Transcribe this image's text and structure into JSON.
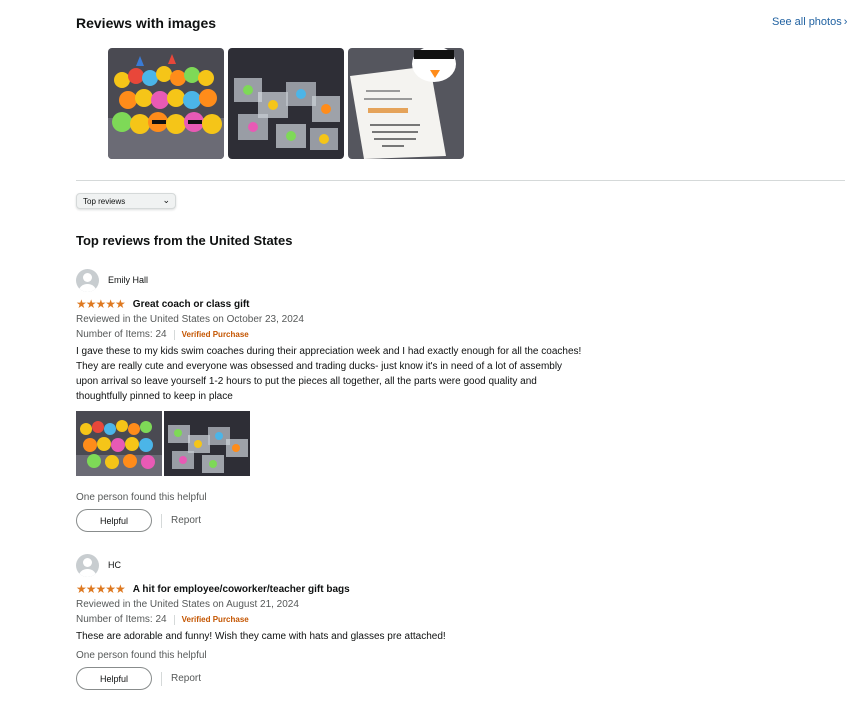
{
  "reviews_with_images": {
    "title": "Reviews with images",
    "see_all_label": "See all photos",
    "see_all_icon": "chevron-right-icon",
    "thumbnails": [
      {
        "name": "colorful rubber ducks with hats and sunglasses"
      },
      {
        "name": "ducks packaged in clear bags"
      },
      {
        "name": "handwritten note card with duck"
      }
    ]
  },
  "sort": {
    "selected": "Top reviews",
    "caret_icon": "chevron-down-icon"
  },
  "section_title": "Top reviews from the United States",
  "star_color": "#de7921",
  "reviews": [
    {
      "author": "Emily Hall",
      "stars": "★★★★★",
      "rating": 5,
      "title": "Great coach or class gift",
      "date_line": "Reviewed in the United States on October 23, 2024",
      "items_line": "Number of Items: 24",
      "verified": "Verified Purchase",
      "body": "I gave these to my kids swim coaches during their appreciation week and I had exactly enough for all the coaches! They are really cute and everyone was obsessed and trading ducks- just know it's in need of a lot of assembly upon arrival so leave yourself 1-2 hours to put the pieces all together, all the parts were good quality and thoughtfully pinned to keep in place",
      "helpful_text": "One person found this helpful",
      "helpful_button": "Helpful",
      "report": "Report"
    },
    {
      "author": "HC",
      "stars": "★★★★★",
      "rating": 5,
      "title": "A hit for employee/coworker/teacher gift bags",
      "date_line": "Reviewed in the United States on August 21, 2024",
      "items_line": "Number of Items: 24",
      "verified": "Verified Purchase",
      "body": "These are adorable and funny! Wish they came with hats and glasses pre attached!",
      "helpful_text": "One person found this helpful",
      "helpful_button": "Helpful",
      "report": "Report"
    }
  ]
}
